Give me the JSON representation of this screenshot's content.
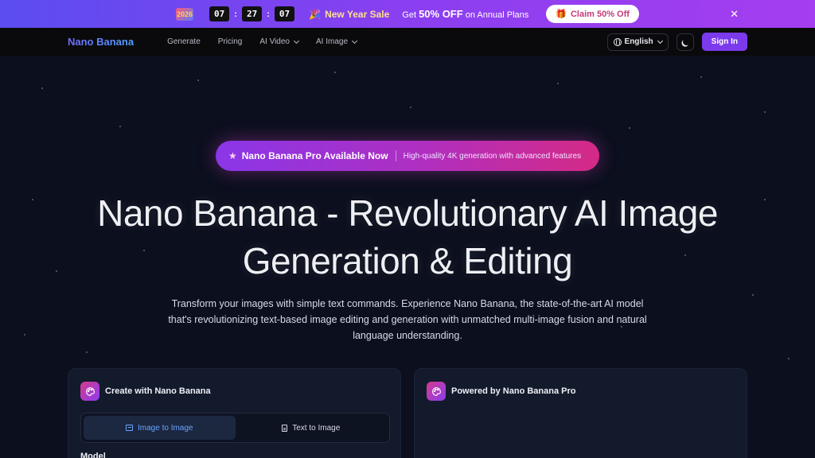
{
  "promo": {
    "year_badge": "2026",
    "timer": [
      "07",
      "27",
      "07"
    ],
    "party_emoji": "🎉",
    "sale_title": "New Year Sale",
    "offer_prefix": "Get",
    "offer_highlight": "50% OFF",
    "offer_suffix": "on Annual Plans",
    "claim_label": "Claim 50% Off",
    "close_glyph": "✕"
  },
  "nav": {
    "brand": "Nano Banana",
    "links": [
      {
        "label": "Generate",
        "dropdown": false
      },
      {
        "label": "Pricing",
        "dropdown": false
      },
      {
        "label": "AI Video",
        "dropdown": true
      },
      {
        "label": "AI Image",
        "dropdown": true
      }
    ],
    "language": "English",
    "sign_in": "Sign In"
  },
  "hero": {
    "pill_title": "Nano Banana Pro Available Now",
    "pill_subtitle": "High-quality 4K generation with advanced features",
    "headline_line1": "Nano Banana - Revolutionary AI Image",
    "headline_line2": "Generation & Editing",
    "subtext": "Transform your images with simple text commands. Experience Nano Banana, the state-of-the-art AI model that's revolutionizing text-based image editing and generation with unmatched multi-image fusion and natural language understanding."
  },
  "create_card": {
    "title": "Create with Nano Banana",
    "tabs": [
      {
        "label": "Image to Image",
        "icon": "image-icon",
        "active": true
      },
      {
        "label": "Text to Image",
        "icon": "document-icon",
        "active": false
      }
    ],
    "model_label": "Model"
  },
  "output_card": {
    "title": "Powered by Nano Banana Pro"
  },
  "colors": {
    "accent": "#7c3aed",
    "background": "#0b0f1e",
    "active_tab_text": "#6aa4ff"
  }
}
